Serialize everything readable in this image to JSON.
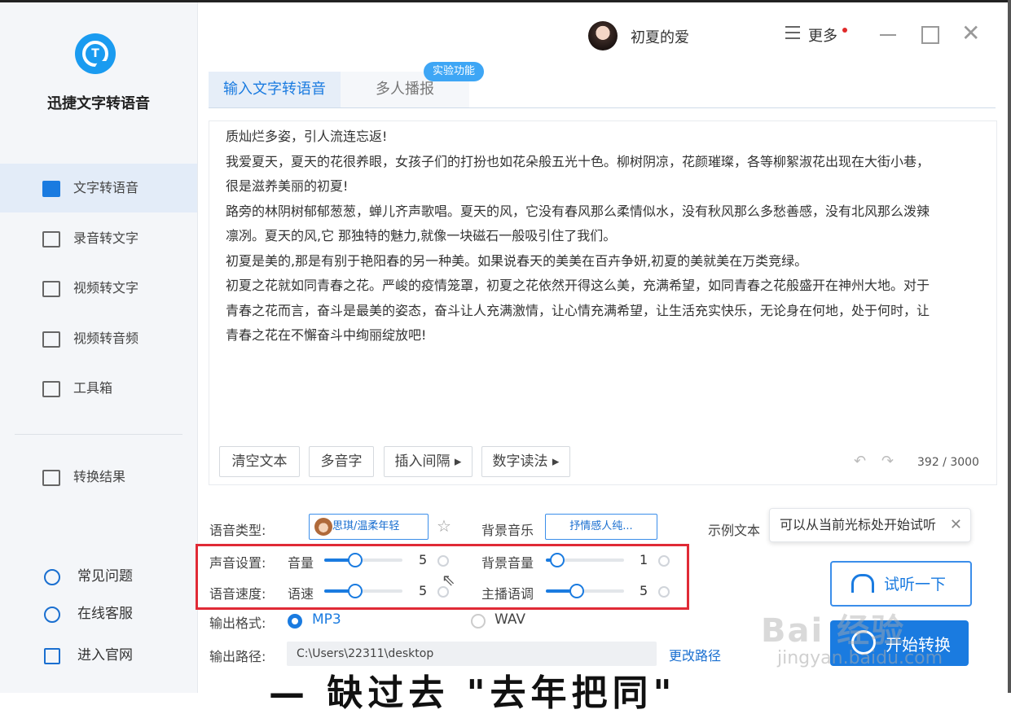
{
  "app": {
    "name": "迅捷文字转语音"
  },
  "sidebar": {
    "items": [
      {
        "label": "文字转语音",
        "active": true
      },
      {
        "label": "录音转文字"
      },
      {
        "label": "视频转文字"
      },
      {
        "label": "视频转音频"
      },
      {
        "label": "工具箱"
      },
      {
        "label": "转换结果"
      }
    ],
    "bottom": [
      {
        "label": "常见问题"
      },
      {
        "label": "在线客服"
      },
      {
        "label": "进入官网"
      }
    ]
  },
  "topbar": {
    "username": "初夏的爱",
    "more": "更多"
  },
  "tabs": [
    {
      "label": "输入文字转语音",
      "active": true
    },
    {
      "label": "多人播报"
    }
  ],
  "badge": "实验功能",
  "editor": {
    "lines": [
      "质灿烂多姿，引人流连忘返!",
      "我爱夏天，夏天的花很养眼，女孩子们的打扮也如花朵般五光十色。柳树阴凉，花颜璀璨，各等柳絮淑花出现在大街小巷，",
      "很是滋养美丽的初夏!",
      "路旁的林阴树郁郁葱葱，蝉儿齐声歌唱。夏天的风，它没有春风那么柔情似水，没有秋风那么多愁善感，没有北风那么泼辣",
      "凛冽。夏天的风,它 那独特的魅力,就像一块磁石一般吸引住了我们。",
      "初夏是美的,那是有别于艳阳春的另一种美。如果说春天的美美在百卉争妍,初夏的美就美在万类竞绿。",
      "初夏之花就如同青春之花。严峻的疫情笼罩，初夏之花依然开得这么美，充满希望，如同青春之花般盛开在神州大地。对于",
      "青春之花而言，奋斗是最美的姿态，奋斗让人充满激情，让心情充满希望，让生活充实快乐，无论身在何地，处于何时，让",
      "青春之花在不懈奋斗中绚丽绽放吧!"
    ],
    "buttons": {
      "clear": "清空文本",
      "polyphone": "多音字",
      "pause": "插入间隔 ▸",
      "number": "数字读法 ▸"
    },
    "count": "392 / 3000"
  },
  "settings": {
    "voice_type_label": "语音类型:",
    "voice": "思琪/温柔年轻",
    "bgm_label": "背景音乐",
    "bgm": "抒情感人纯...",
    "sample_label": "示例文本",
    "tip": "可以从当前光标处开始试听",
    "sound_label": "声音设置:",
    "volume_label": "音量",
    "volume_value": "5",
    "bg_volume_label": "背景音量",
    "bg_volume_value": "1",
    "speed_row_label": "语音速度:",
    "speed_label": "语速",
    "speed_value": "5",
    "pitch_label": "主播语调",
    "pitch_value": "5",
    "levels": {
      "volume": 0.4,
      "bg_volume": 0.15,
      "speed": 0.4,
      "pitch": 0.4
    },
    "format_label": "输出格式:",
    "format_mp3": "MP3",
    "format_wav": "WAV",
    "path_label": "输出路径:",
    "path": "C:\\Users\\22311\\desktop",
    "change_path": "更改路径"
  },
  "actions": {
    "listen": "试听一下",
    "start": "开始转换"
  },
  "watermark": {
    "top": "Bai 经验",
    "bottom": "jingyan.baidu.com"
  },
  "bottom_text": "—  缺过去 \"去年把同\""
}
